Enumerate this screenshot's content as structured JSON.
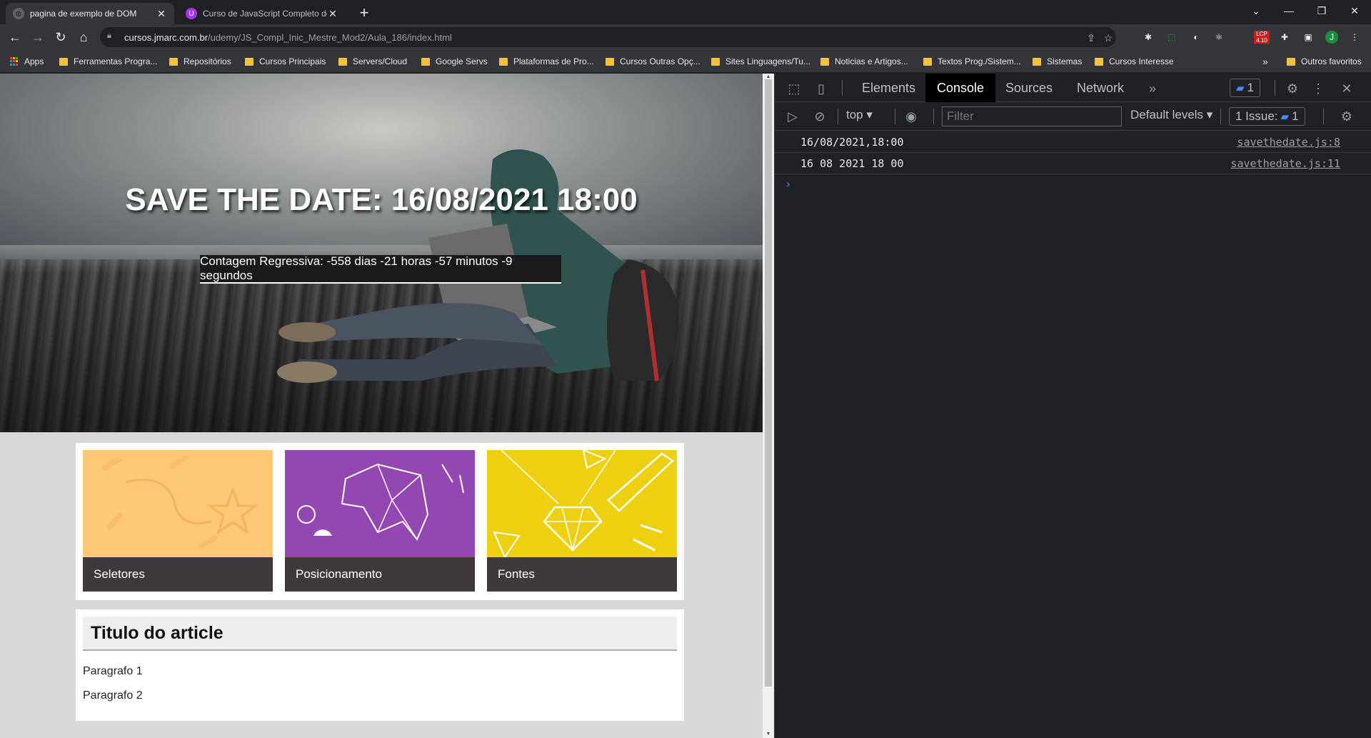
{
  "tabs": [
    {
      "title": "pagina de exemplo de DOM",
      "active": true
    },
    {
      "title": "Curso de JavaScript Completo do Iniciante ao Mestre",
      "active": false
    }
  ],
  "toolbar": {
    "url_host": "cursos.jmarc.com.br",
    "url_path": "/udemy/JS_Compl_Inic_Mestre_Mod2/Aula_186/index.html",
    "lcp_badge": "4.10",
    "avatar_letter": "J"
  },
  "bookmarks": {
    "apps": "Apps",
    "items": [
      "Ferramentas Progra...",
      "Repositórios",
      "Cursos Principais",
      "Servers/Cloud",
      "Google Servs",
      "Plataformas de Pro...",
      "Cursos Outras Opç...",
      "Sites Linguagens/Tu...",
      "Noticias e Artigos...",
      "Textos Prog./Sistem...",
      "Sistemas",
      "Cursos Interesse"
    ],
    "more": "»",
    "other": "Outros favoritos"
  },
  "page": {
    "hero_title": "SAVE THE DATE: 16/08/2021 18:00",
    "countdown": "Contagem Regressiva: -558 dias -21 horas -57 minutos -9 segundos",
    "cards": [
      "Seletores",
      "Posicionamento",
      "Fontes"
    ],
    "card_colors": [
      "#fec877",
      "#9247b3",
      "#efd010"
    ],
    "article_title": "Titulo do article",
    "paragraphs": [
      "Paragrafo 1",
      "Paragrafo 2"
    ]
  },
  "devtools": {
    "tabs": [
      "Elements",
      "Console",
      "Sources",
      "Network"
    ],
    "active_tab": "Console",
    "messages_badge": "1",
    "context": "top",
    "filter_placeholder": "Filter",
    "levels": "Default levels",
    "issues_label": "1 Issue:",
    "issues_count": "1",
    "console": [
      {
        "msg": "16/08/2021,18:00",
        "src": "savethedate.js:8"
      },
      {
        "msg": "16 08 2021 18 00",
        "src": "savethedate.js:11"
      }
    ],
    "prompt": "›"
  }
}
